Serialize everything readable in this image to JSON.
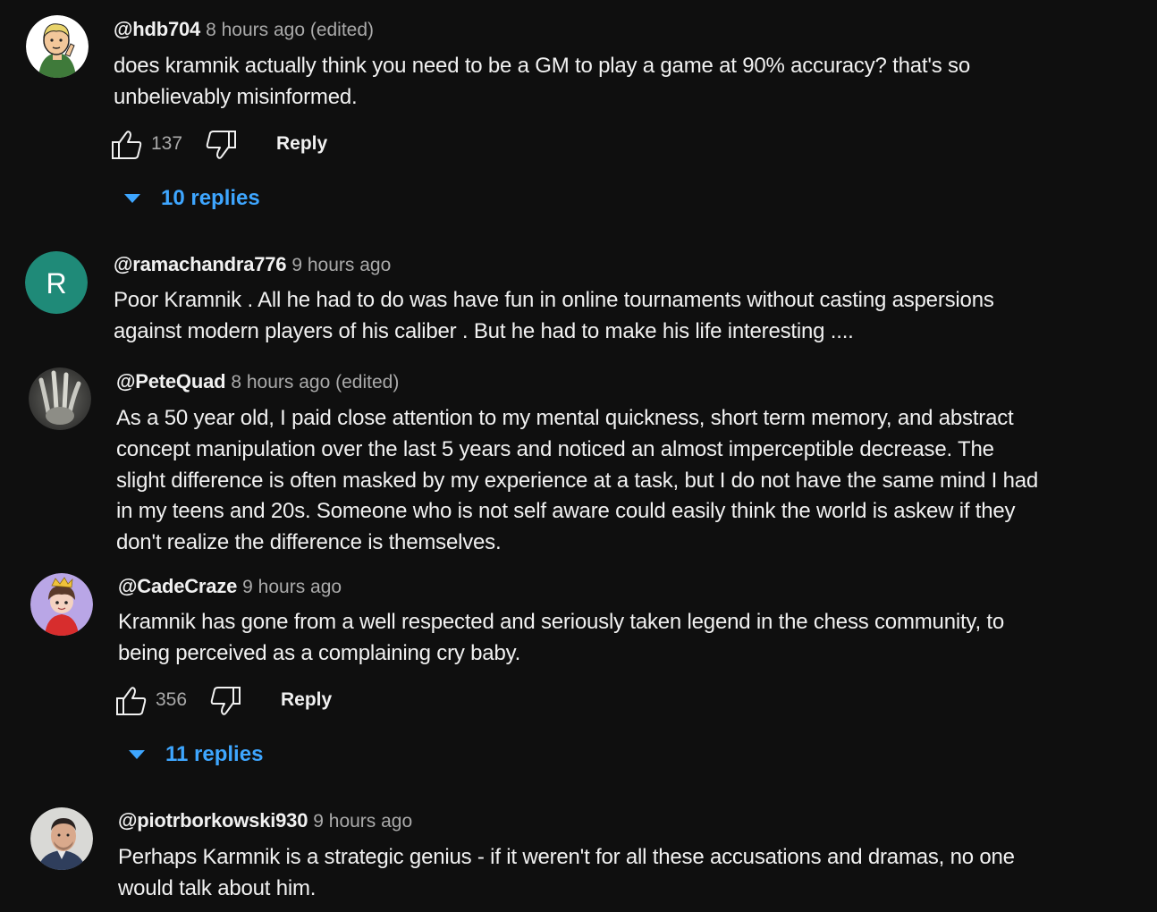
{
  "comments": [
    {
      "author": "@hdb704",
      "time": "8 hours ago (edited)",
      "text": "does kramnik actually think you need to be a GM to play a game at 90% accuracy? that's so\nunbelievably misinformed.",
      "likes": "137",
      "reply_label": "Reply",
      "replies_label": "10 replies",
      "avatar_icon": "cartoon-person-avatar"
    },
    {
      "author": "@ramachandra776",
      "time": "9 hours ago",
      "text": "Poor Kramnik . All he had to do was have fun in online tournaments without casting aspersions\nagainst modern players of his caliber . But he had to make his life interesting ....",
      "avatar_letter": "R",
      "avatar_color": "#1f8a78"
    },
    {
      "author": "@PeteQuad",
      "time": "8 hours ago (edited)",
      "text": "As a 50 year old, I paid close attention to my mental quickness, short term memory, and abstract\nconcept manipulation over the last 5 years and noticed an almost imperceptible decrease.  The\nslight difference is often masked by my experience at a task, but I do not have the same mind I had\nin my teens and 20s.  Someone who is not self aware could easily think the world is askew if they\ndon't realize the difference is themselves.",
      "avatar_icon": "hand-photo-avatar"
    },
    {
      "author": "@CadeCraze",
      "time": "9 hours ago",
      "text": "Kramnik has gone from a well respected and seriously taken legend in the chess community, to\nbeing perceived as a complaining cry baby.",
      "likes": "356",
      "reply_label": "Reply",
      "replies_label": "11 replies",
      "avatar_icon": "anime-character-avatar"
    },
    {
      "author": "@piotrborkowski930",
      "time": "9 hours ago",
      "text": "Perhaps Karmnik is a strategic genius - if it weren't for all these accusations and dramas, no one\nwould talk about him.",
      "avatar_icon": "man-portrait-avatar"
    }
  ],
  "colors": {
    "background": "#0f0f0f",
    "text": "#f1f1f1",
    "secondary": "#aaaaaa",
    "link": "#3ea6ff"
  }
}
